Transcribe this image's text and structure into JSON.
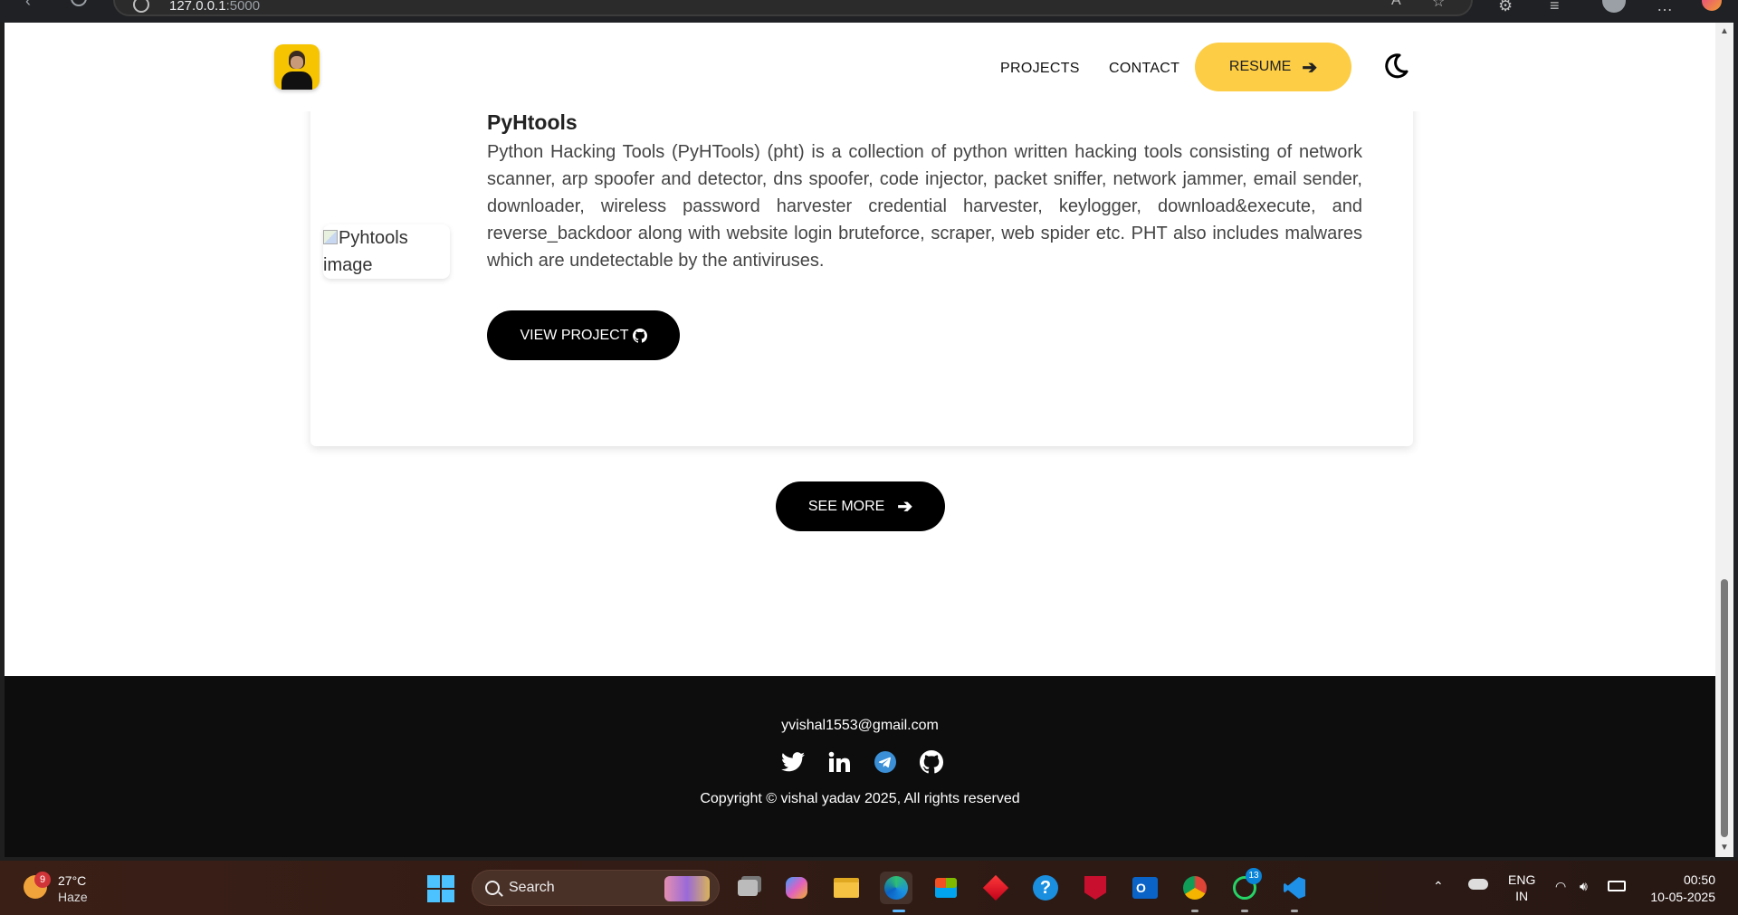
{
  "browser": {
    "url_host": "127.0.0.1",
    "url_port": ":5000"
  },
  "nav": {
    "projects": "PROJECTS",
    "contact": "CONTACT",
    "resume": "RESUME"
  },
  "project": {
    "title": "PyHtools",
    "image_alt": "Pyhtools image",
    "description": "Python Hacking Tools (PyHTools) (pht) is a collection of python written hacking tools consisting of network scanner, arp spoofer and detector, dns spoofer, code injector, packet sniffer, network jammer, email sender, downloader, wireless password harvester credential harvester, keylogger, download&execute, and reverse_backdoor along with website login bruteforce, scraper, web spider etc. PHT also includes malwares which are undetectable by the antiviruses.",
    "button": "VIEW PROJECT"
  },
  "see_more": "SEE MORE",
  "footer": {
    "email": "yvishal1553@gmail.com",
    "socials": [
      "twitter-icon",
      "linkedin-icon",
      "telegram-icon",
      "github-icon"
    ],
    "copyright": "Copyright © vishal yadav 2025, All rights reserved"
  },
  "taskbar": {
    "weather_badge": "9",
    "temperature": "27°C",
    "condition": "Haze",
    "search": "Search",
    "chrome_badge": "",
    "whatsapp_badge": "13",
    "language_top": "ENG",
    "language_bottom": "IN",
    "time": "00:50",
    "date": "10-05-2025"
  },
  "colors": {
    "accent": "#fccd45",
    "footer_bg": "#0d0d0d",
    "button_bg": "#000000"
  }
}
